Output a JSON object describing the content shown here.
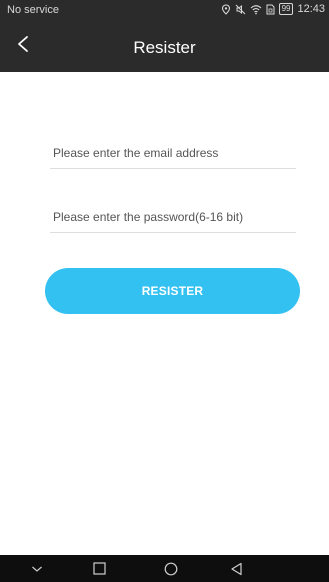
{
  "status_bar": {
    "carrier": "No service",
    "battery": "99",
    "time": "12:43"
  },
  "header": {
    "title": "Resister"
  },
  "form": {
    "email_placeholder": "Please enter the email address",
    "password_placeholder": "Please enter the password(6-16 bit)",
    "submit_label": "RESISTER"
  },
  "colors": {
    "topbar": "#2b2b2b",
    "button": "#33c1f2",
    "navbar": "#0e0e0e"
  },
  "icons": {
    "back": "chevron-left-icon",
    "status": [
      "location-icon",
      "mute-icon",
      "wifi-icon",
      "sim-icon",
      "battery-icon"
    ],
    "nav": [
      "chevron-down-icon",
      "square-icon",
      "circle-icon",
      "triangle-back-icon"
    ]
  }
}
